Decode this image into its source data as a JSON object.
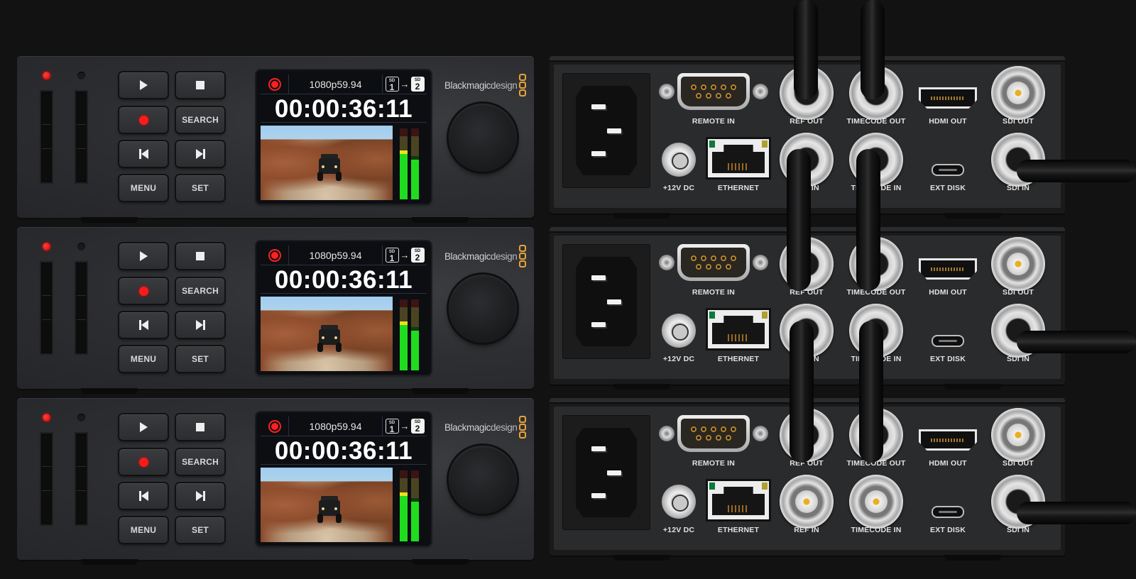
{
  "scene": "Blackmagic HyperDeck Studio HD Mini — three stacked units, front and rear views",
  "colors": {
    "background": "#121212",
    "record_red": "#ff1a1a",
    "meter_green": "#1fdc1f",
    "meter_peak": "#f0e01a",
    "logo_orange": "#e8a33a",
    "bnc_pin_gold": "#e8b020"
  },
  "front_units": [
    {
      "leds": [
        {
          "name": "slot-1-led",
          "state": "red"
        },
        {
          "name": "slot-2-led",
          "state": "off"
        }
      ],
      "buttons": {
        "play": {
          "icon": "play-icon"
        },
        "stop": {
          "icon": "stop-icon"
        },
        "record": {
          "icon": "record-icon"
        },
        "search": {
          "label": "SEARCH"
        },
        "prev": {
          "icon": "skip-back-icon"
        },
        "next": {
          "icon": "skip-forward-icon"
        },
        "menu": {
          "label": "MENU"
        },
        "set": {
          "label": "SET"
        }
      },
      "lcd": {
        "status_icon": "record-indicator-icon",
        "format": "1080p59.94",
        "sd_from": {
          "label": "SD",
          "number": "1"
        },
        "sd_to": {
          "label": "SD",
          "number": "2"
        },
        "timecode": "00:00:36:11",
        "video_icon": "jeep-canyon-preview",
        "audio_meters": [
          {
            "level": 0.64,
            "peak": 0.67
          },
          {
            "level": 0.56,
            "peak": 0.6
          }
        ]
      },
      "logo": {
        "brand": "Blackmagic",
        "suffix": "design"
      },
      "knob_icon": "search-dial-icon"
    },
    {
      "leds": [
        {
          "name": "slot-1-led",
          "state": "red"
        },
        {
          "name": "slot-2-led",
          "state": "off"
        }
      ],
      "buttons": {
        "play": {
          "icon": "play-icon"
        },
        "stop": {
          "icon": "stop-icon"
        },
        "record": {
          "icon": "record-icon"
        },
        "search": {
          "label": "SEARCH"
        },
        "prev": {
          "icon": "skip-back-icon"
        },
        "next": {
          "icon": "skip-forward-icon"
        },
        "menu": {
          "label": "MENU"
        },
        "set": {
          "label": "SET"
        }
      },
      "lcd": {
        "status_icon": "record-indicator-icon",
        "format": "1080p59.94",
        "sd_from": {
          "label": "SD",
          "number": "1"
        },
        "sd_to": {
          "label": "SD",
          "number": "2"
        },
        "timecode": "00:00:36:11",
        "video_icon": "jeep-canyon-preview",
        "audio_meters": [
          {
            "level": 0.64,
            "peak": 0.67
          },
          {
            "level": 0.56,
            "peak": 0.6
          }
        ]
      },
      "logo": {
        "brand": "Blackmagic",
        "suffix": "design"
      },
      "knob_icon": "search-dial-icon"
    },
    {
      "leds": [
        {
          "name": "slot-1-led",
          "state": "red"
        },
        {
          "name": "slot-2-led",
          "state": "off"
        }
      ],
      "buttons": {
        "play": {
          "icon": "play-icon"
        },
        "stop": {
          "icon": "stop-icon"
        },
        "record": {
          "icon": "record-icon"
        },
        "search": {
          "label": "SEARCH"
        },
        "prev": {
          "icon": "skip-back-icon"
        },
        "next": {
          "icon": "skip-forward-icon"
        },
        "menu": {
          "label": "MENU"
        },
        "set": {
          "label": "SET"
        }
      },
      "lcd": {
        "status_icon": "record-indicator-icon",
        "format": "1080p59.94",
        "sd_from": {
          "label": "SD",
          "number": "1"
        },
        "sd_to": {
          "label": "SD",
          "number": "2"
        },
        "timecode": "00:00:36:11",
        "video_icon": "jeep-canyon-preview",
        "audio_meters": [
          {
            "level": 0.64,
            "peak": 0.67
          },
          {
            "level": 0.56,
            "peak": 0.6
          }
        ]
      },
      "logo": {
        "brand": "Blackmagic",
        "suffix": "design"
      },
      "knob_icon": "search-dial-icon"
    }
  ],
  "rear_units": [
    {
      "ports": {
        "power": {
          "label": "",
          "icon": "iec-power-inlet-icon"
        },
        "remote_in": {
          "label": "REMOTE IN"
        },
        "dc_in": {
          "label": "+12V DC"
        },
        "ethernet": {
          "label": "ETHERNET"
        },
        "ref_out": {
          "label": "REF OUT",
          "cabled": true
        },
        "ref_in": {
          "label": "REF IN",
          "cabled": true
        },
        "timecode_out": {
          "label": "TIMECODE OUT",
          "cabled": true
        },
        "timecode_in": {
          "label": "TIMECODE IN",
          "cabled": true
        },
        "hdmi_out": {
          "label": "HDMI OUT"
        },
        "ext_disk": {
          "label": "EXT DISK"
        },
        "sdi_out": {
          "label": "SDI OUT",
          "cabled": false
        },
        "sdi_in": {
          "label": "SDI IN",
          "cabled": true
        }
      }
    },
    {
      "ports": {
        "power": {
          "label": "",
          "icon": "iec-power-inlet-icon"
        },
        "remote_in": {
          "label": "REMOTE IN"
        },
        "dc_in": {
          "label": "+12V DC"
        },
        "ethernet": {
          "label": "ETHERNET"
        },
        "ref_out": {
          "label": "REF OUT",
          "cabled": true
        },
        "ref_in": {
          "label": "REF IN",
          "cabled": true
        },
        "timecode_out": {
          "label": "TIMECODE OUT",
          "cabled": true
        },
        "timecode_in": {
          "label": "TIMECODE IN",
          "cabled": true
        },
        "hdmi_out": {
          "label": "HDMI OUT"
        },
        "ext_disk": {
          "label": "EXT DISK"
        },
        "sdi_out": {
          "label": "SDI OUT",
          "cabled": false
        },
        "sdi_in": {
          "label": "SDI IN",
          "cabled": true
        }
      }
    },
    {
      "ports": {
        "power": {
          "label": "",
          "icon": "iec-power-inlet-icon"
        },
        "remote_in": {
          "label": "REMOTE IN"
        },
        "dc_in": {
          "label": "+12V DC"
        },
        "ethernet": {
          "label": "ETHERNET"
        },
        "ref_out": {
          "label": "REF OUT",
          "cabled": true
        },
        "ref_in": {
          "label": "REF IN",
          "cabled": false
        },
        "timecode_out": {
          "label": "TIMECODE OUT",
          "cabled": true
        },
        "timecode_in": {
          "label": "TIMECODE IN",
          "cabled": false
        },
        "hdmi_out": {
          "label": "HDMI OUT"
        },
        "ext_disk": {
          "label": "EXT DISK"
        },
        "sdi_out": {
          "label": "SDI OUT",
          "cabled": false
        },
        "sdi_in": {
          "label": "SDI IN",
          "cabled": true
        }
      }
    }
  ]
}
